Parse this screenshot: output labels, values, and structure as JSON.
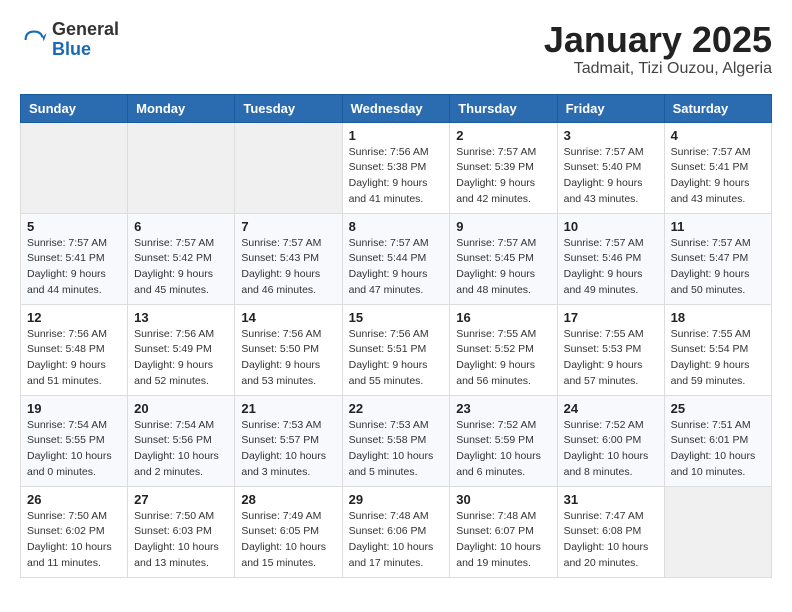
{
  "header": {
    "logo_general": "General",
    "logo_blue": "Blue",
    "month_title": "January 2025",
    "subtitle": "Tadmait, Tizi Ouzou, Algeria"
  },
  "weekdays": [
    "Sunday",
    "Monday",
    "Tuesday",
    "Wednesday",
    "Thursday",
    "Friday",
    "Saturday"
  ],
  "weeks": [
    [
      {
        "day": "",
        "info": ""
      },
      {
        "day": "",
        "info": ""
      },
      {
        "day": "",
        "info": ""
      },
      {
        "day": "1",
        "info": "Sunrise: 7:56 AM\nSunset: 5:38 PM\nDaylight: 9 hours and 41 minutes."
      },
      {
        "day": "2",
        "info": "Sunrise: 7:57 AM\nSunset: 5:39 PM\nDaylight: 9 hours and 42 minutes."
      },
      {
        "day": "3",
        "info": "Sunrise: 7:57 AM\nSunset: 5:40 PM\nDaylight: 9 hours and 43 minutes."
      },
      {
        "day": "4",
        "info": "Sunrise: 7:57 AM\nSunset: 5:41 PM\nDaylight: 9 hours and 43 minutes."
      }
    ],
    [
      {
        "day": "5",
        "info": "Sunrise: 7:57 AM\nSunset: 5:41 PM\nDaylight: 9 hours and 44 minutes."
      },
      {
        "day": "6",
        "info": "Sunrise: 7:57 AM\nSunset: 5:42 PM\nDaylight: 9 hours and 45 minutes."
      },
      {
        "day": "7",
        "info": "Sunrise: 7:57 AM\nSunset: 5:43 PM\nDaylight: 9 hours and 46 minutes."
      },
      {
        "day": "8",
        "info": "Sunrise: 7:57 AM\nSunset: 5:44 PM\nDaylight: 9 hours and 47 minutes."
      },
      {
        "day": "9",
        "info": "Sunrise: 7:57 AM\nSunset: 5:45 PM\nDaylight: 9 hours and 48 minutes."
      },
      {
        "day": "10",
        "info": "Sunrise: 7:57 AM\nSunset: 5:46 PM\nDaylight: 9 hours and 49 minutes."
      },
      {
        "day": "11",
        "info": "Sunrise: 7:57 AM\nSunset: 5:47 PM\nDaylight: 9 hours and 50 minutes."
      }
    ],
    [
      {
        "day": "12",
        "info": "Sunrise: 7:56 AM\nSunset: 5:48 PM\nDaylight: 9 hours and 51 minutes."
      },
      {
        "day": "13",
        "info": "Sunrise: 7:56 AM\nSunset: 5:49 PM\nDaylight: 9 hours and 52 minutes."
      },
      {
        "day": "14",
        "info": "Sunrise: 7:56 AM\nSunset: 5:50 PM\nDaylight: 9 hours and 53 minutes."
      },
      {
        "day": "15",
        "info": "Sunrise: 7:56 AM\nSunset: 5:51 PM\nDaylight: 9 hours and 55 minutes."
      },
      {
        "day": "16",
        "info": "Sunrise: 7:55 AM\nSunset: 5:52 PM\nDaylight: 9 hours and 56 minutes."
      },
      {
        "day": "17",
        "info": "Sunrise: 7:55 AM\nSunset: 5:53 PM\nDaylight: 9 hours and 57 minutes."
      },
      {
        "day": "18",
        "info": "Sunrise: 7:55 AM\nSunset: 5:54 PM\nDaylight: 9 hours and 59 minutes."
      }
    ],
    [
      {
        "day": "19",
        "info": "Sunrise: 7:54 AM\nSunset: 5:55 PM\nDaylight: 10 hours and 0 minutes."
      },
      {
        "day": "20",
        "info": "Sunrise: 7:54 AM\nSunset: 5:56 PM\nDaylight: 10 hours and 2 minutes."
      },
      {
        "day": "21",
        "info": "Sunrise: 7:53 AM\nSunset: 5:57 PM\nDaylight: 10 hours and 3 minutes."
      },
      {
        "day": "22",
        "info": "Sunrise: 7:53 AM\nSunset: 5:58 PM\nDaylight: 10 hours and 5 minutes."
      },
      {
        "day": "23",
        "info": "Sunrise: 7:52 AM\nSunset: 5:59 PM\nDaylight: 10 hours and 6 minutes."
      },
      {
        "day": "24",
        "info": "Sunrise: 7:52 AM\nSunset: 6:00 PM\nDaylight: 10 hours and 8 minutes."
      },
      {
        "day": "25",
        "info": "Sunrise: 7:51 AM\nSunset: 6:01 PM\nDaylight: 10 hours and 10 minutes."
      }
    ],
    [
      {
        "day": "26",
        "info": "Sunrise: 7:50 AM\nSunset: 6:02 PM\nDaylight: 10 hours and 11 minutes."
      },
      {
        "day": "27",
        "info": "Sunrise: 7:50 AM\nSunset: 6:03 PM\nDaylight: 10 hours and 13 minutes."
      },
      {
        "day": "28",
        "info": "Sunrise: 7:49 AM\nSunset: 6:05 PM\nDaylight: 10 hours and 15 minutes."
      },
      {
        "day": "29",
        "info": "Sunrise: 7:48 AM\nSunset: 6:06 PM\nDaylight: 10 hours and 17 minutes."
      },
      {
        "day": "30",
        "info": "Sunrise: 7:48 AM\nSunset: 6:07 PM\nDaylight: 10 hours and 19 minutes."
      },
      {
        "day": "31",
        "info": "Sunrise: 7:47 AM\nSunset: 6:08 PM\nDaylight: 10 hours and 20 minutes."
      },
      {
        "day": "",
        "info": ""
      }
    ]
  ]
}
